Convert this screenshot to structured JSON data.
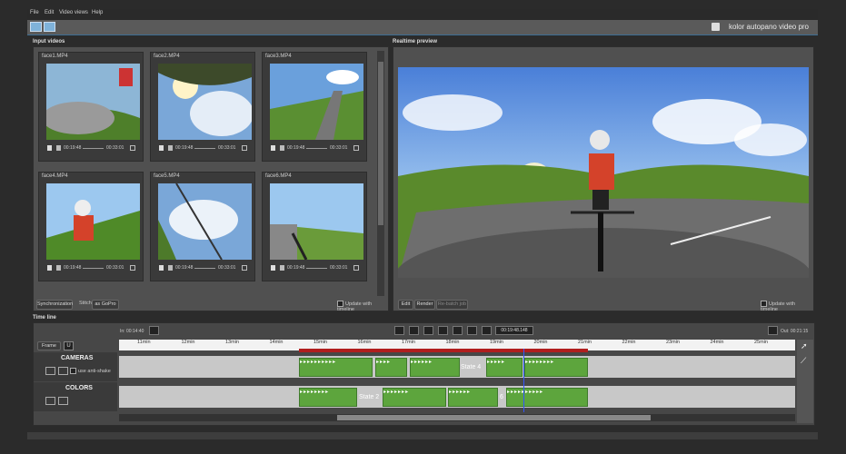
{
  "menu": {
    "items": [
      "File",
      "Edit",
      "Video views",
      "Help"
    ]
  },
  "toolbar": {
    "brand": "kolor autopano video pro"
  },
  "input_panel": {
    "title": "Input videos",
    "videos": [
      {
        "name": "face1.MP4",
        "time_current": "00:19:48",
        "time_total": "00:33:01"
      },
      {
        "name": "face2.MP4",
        "time_current": "00:19:48",
        "time_total": "00:33:01"
      },
      {
        "name": "face3.MP4",
        "time_current": "00:19:48",
        "time_total": "00:33:01"
      },
      {
        "name": "face4.MP4",
        "time_current": "00:19:48",
        "time_total": "00:33:01"
      },
      {
        "name": "face5.MP4",
        "time_current": "00:19:48",
        "time_total": "00:33:01"
      },
      {
        "name": "face6.MP4",
        "time_current": "00:19:48",
        "time_total": "00:33:01"
      }
    ],
    "sync_button": "Synchronization",
    "stitch_label": "Stitch",
    "stitch_value": "as GoPro",
    "update_label": "Update with timeline"
  },
  "preview_panel": {
    "title": "Realtime preview",
    "edit_button": "Edit",
    "render_button": "Render",
    "extra_button": "Re-batch job",
    "update_label": "Update with timeline"
  },
  "timeline": {
    "title": "Time line",
    "in_time": "In: 00:14:40",
    "out_time": "Out: 00:21:15",
    "current_time": "00:19:48.148",
    "frame_button": "Frame",
    "ruler": [
      "11min",
      "12min",
      "13min",
      "14min",
      "15min",
      "16min",
      "17min",
      "18min",
      "19min",
      "20min",
      "21min",
      "22min",
      "23min",
      "24min",
      "25min"
    ],
    "cameras_label": "CAMERAS",
    "anti_shake_label": "use anti-shake",
    "colors_label": "COLORS",
    "cameras_state": "State 4",
    "colors_state": "State 2",
    "colors_state_b": "6"
  },
  "colors": {
    "clip_green": "#5da53d",
    "cursor_blue": "#3355ff",
    "range_red": "#b01e1e"
  }
}
